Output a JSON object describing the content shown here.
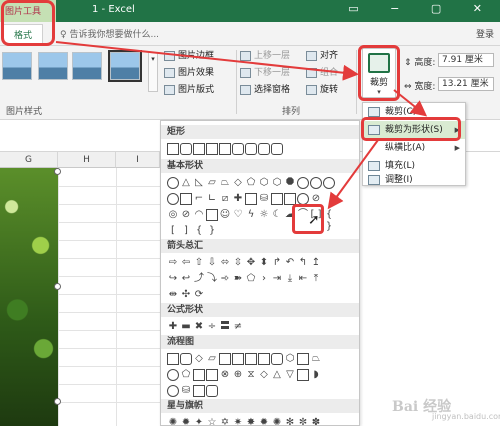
{
  "titlebar": {
    "context_tab": "图片工具",
    "doc_title": "1 - Excel",
    "window_buttons": "▭ − ▢ ✕"
  },
  "tabs": {
    "format": "格式",
    "tell_me": "告诉我你想要做什么...",
    "login": "登录"
  },
  "ribbon": {
    "picture_styles_label": "图片样式",
    "picture_border": "图片边框",
    "picture_effects": "图片效果",
    "picture_layout": "图片版式",
    "bring_forward": "上移一层",
    "send_backward": "下移一层",
    "selection_pane": "选择窗格",
    "align": "对齐",
    "group": "组合",
    "rotate": "旋转",
    "arrange_label": "排列",
    "crop": "裁剪",
    "height_label": "高度:",
    "height_value": "7.91 厘米",
    "width_label": "宽度:",
    "width_value": "13.21 厘米",
    "gallery_arrow": "▾"
  },
  "sheet": {
    "columns": [
      "G",
      "H",
      "I"
    ]
  },
  "crop_menu": {
    "items": [
      {
        "label": "裁剪(C)",
        "icon": "crop-icon"
      },
      {
        "label": "裁剪为形状(S)",
        "icon": "crop-shape-icon"
      },
      {
        "label": "纵横比(A)",
        "icon": ""
      },
      {
        "label": "填充(L)",
        "icon": "fill-icon"
      },
      {
        "label": "调整(I)",
        "icon": "fit-icon"
      }
    ],
    "submenu_arrow": "▶"
  },
  "shapes_gallery": {
    "categories": [
      "矩形",
      "基本形状",
      "箭头总汇",
      "公式形状",
      "流程图",
      "星与旗帜"
    ]
  },
  "watermark": {
    "brand": "Bai 经验",
    "sub": "jingyan.baidu.com"
  },
  "colors": {
    "excel_green": "#217346",
    "annotation_red": "#e33b3b",
    "active_menu": "#d9ebd2"
  }
}
